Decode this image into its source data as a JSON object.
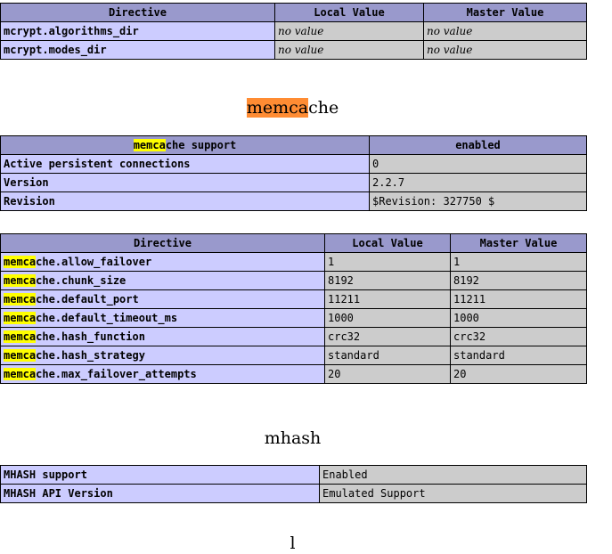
{
  "mcrypt_table": {
    "headers": [
      "Directive",
      "Local Value",
      "Master Value"
    ],
    "rows": [
      {
        "directive": "mcrypt.algorithms_dir",
        "local": "no value",
        "master": "no value"
      },
      {
        "directive": "mcrypt.modes_dir",
        "local": "no value",
        "master": "no value"
      }
    ]
  },
  "memcache_section": {
    "title_highlight": "memca",
    "title_rest": "che",
    "support_table": {
      "header_highlight": "memca",
      "header_rest": "che support",
      "header_value": "enabled",
      "rows": [
        {
          "label": "Active persistent connections",
          "value": "0"
        },
        {
          "label": "Version",
          "value": "2.2.7"
        },
        {
          "label": "Revision",
          "value": "$Revision: 327750 $"
        }
      ]
    },
    "directive_table": {
      "headers": [
        "Directive",
        "Local Value",
        "Master Value"
      ],
      "rows": [
        {
          "highlight": "memca",
          "rest": "che.allow_failover",
          "local": "1",
          "master": "1"
        },
        {
          "highlight": "memca",
          "rest": "che.chunk_size",
          "local": "8192",
          "master": "8192"
        },
        {
          "highlight": "memca",
          "rest": "che.default_port",
          "local": "11211",
          "master": "11211"
        },
        {
          "highlight": "memca",
          "rest": "che.default_timeout_ms",
          "local": "1000",
          "master": "1000"
        },
        {
          "highlight": "memca",
          "rest": "che.hash_function",
          "local": "crc32",
          "master": "crc32"
        },
        {
          "highlight": "memca",
          "rest": "che.hash_strategy",
          "local": "standard",
          "master": "standard"
        },
        {
          "highlight": "memca",
          "rest": "che.max_failover_attempts",
          "local": "20",
          "master": "20"
        }
      ]
    }
  },
  "mhash_section": {
    "title": "mhash",
    "rows": [
      {
        "label": "MHASH support",
        "value": "Enabled"
      },
      {
        "label": "MHASH API Version",
        "value": "Emulated Support"
      }
    ]
  },
  "next_section": {
    "title_partial": "l"
  },
  "colors": {
    "header_bg": "#9999cc",
    "label_bg": "#ccccff",
    "value_bg": "#cccccc",
    "search_highlight": "#ffff00",
    "active_highlight": "#ff8c33"
  }
}
